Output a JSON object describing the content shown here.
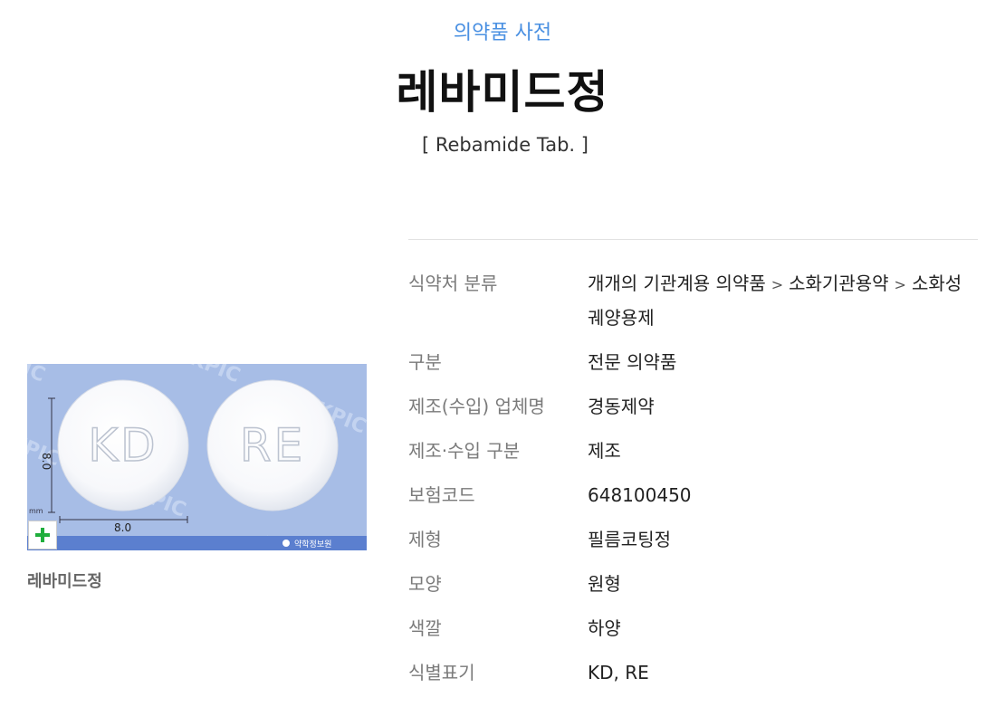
{
  "header": {
    "category_link": "의약품 사전",
    "title": "레바미드정",
    "subtitle": "[ Rebamide Tab. ]"
  },
  "figure": {
    "caption": "레바미드정",
    "pill_left_marking": "KD",
    "pill_right_marking": "RE",
    "height_dim": "8.0",
    "width_dim": "8.0",
    "watermark": "KPIC",
    "unit": "mm",
    "footer_logo": "약학정보원",
    "background_color": "#a7bde6",
    "footer_color": "#5b7fcf"
  },
  "info": {
    "rows": [
      {
        "label": "식약처 분류",
        "path": [
          "개개의 기관계용 의약품",
          "소화기관용약",
          "소화성궤양용제"
        ],
        "separator": ">"
      },
      {
        "label": "구분",
        "value": "전문 의약품"
      },
      {
        "label": "제조(수입) 업체명",
        "value": "경동제약"
      },
      {
        "label": "제조·수입 구분",
        "value": "제조"
      },
      {
        "label": "보험코드",
        "value": "648100450"
      },
      {
        "label": "제형",
        "value": "필름코팅정"
      },
      {
        "label": "모양",
        "value": "원형"
      },
      {
        "label": "색깔",
        "value": "하양"
      },
      {
        "label": "식별표기",
        "value": "KD, RE"
      }
    ]
  }
}
